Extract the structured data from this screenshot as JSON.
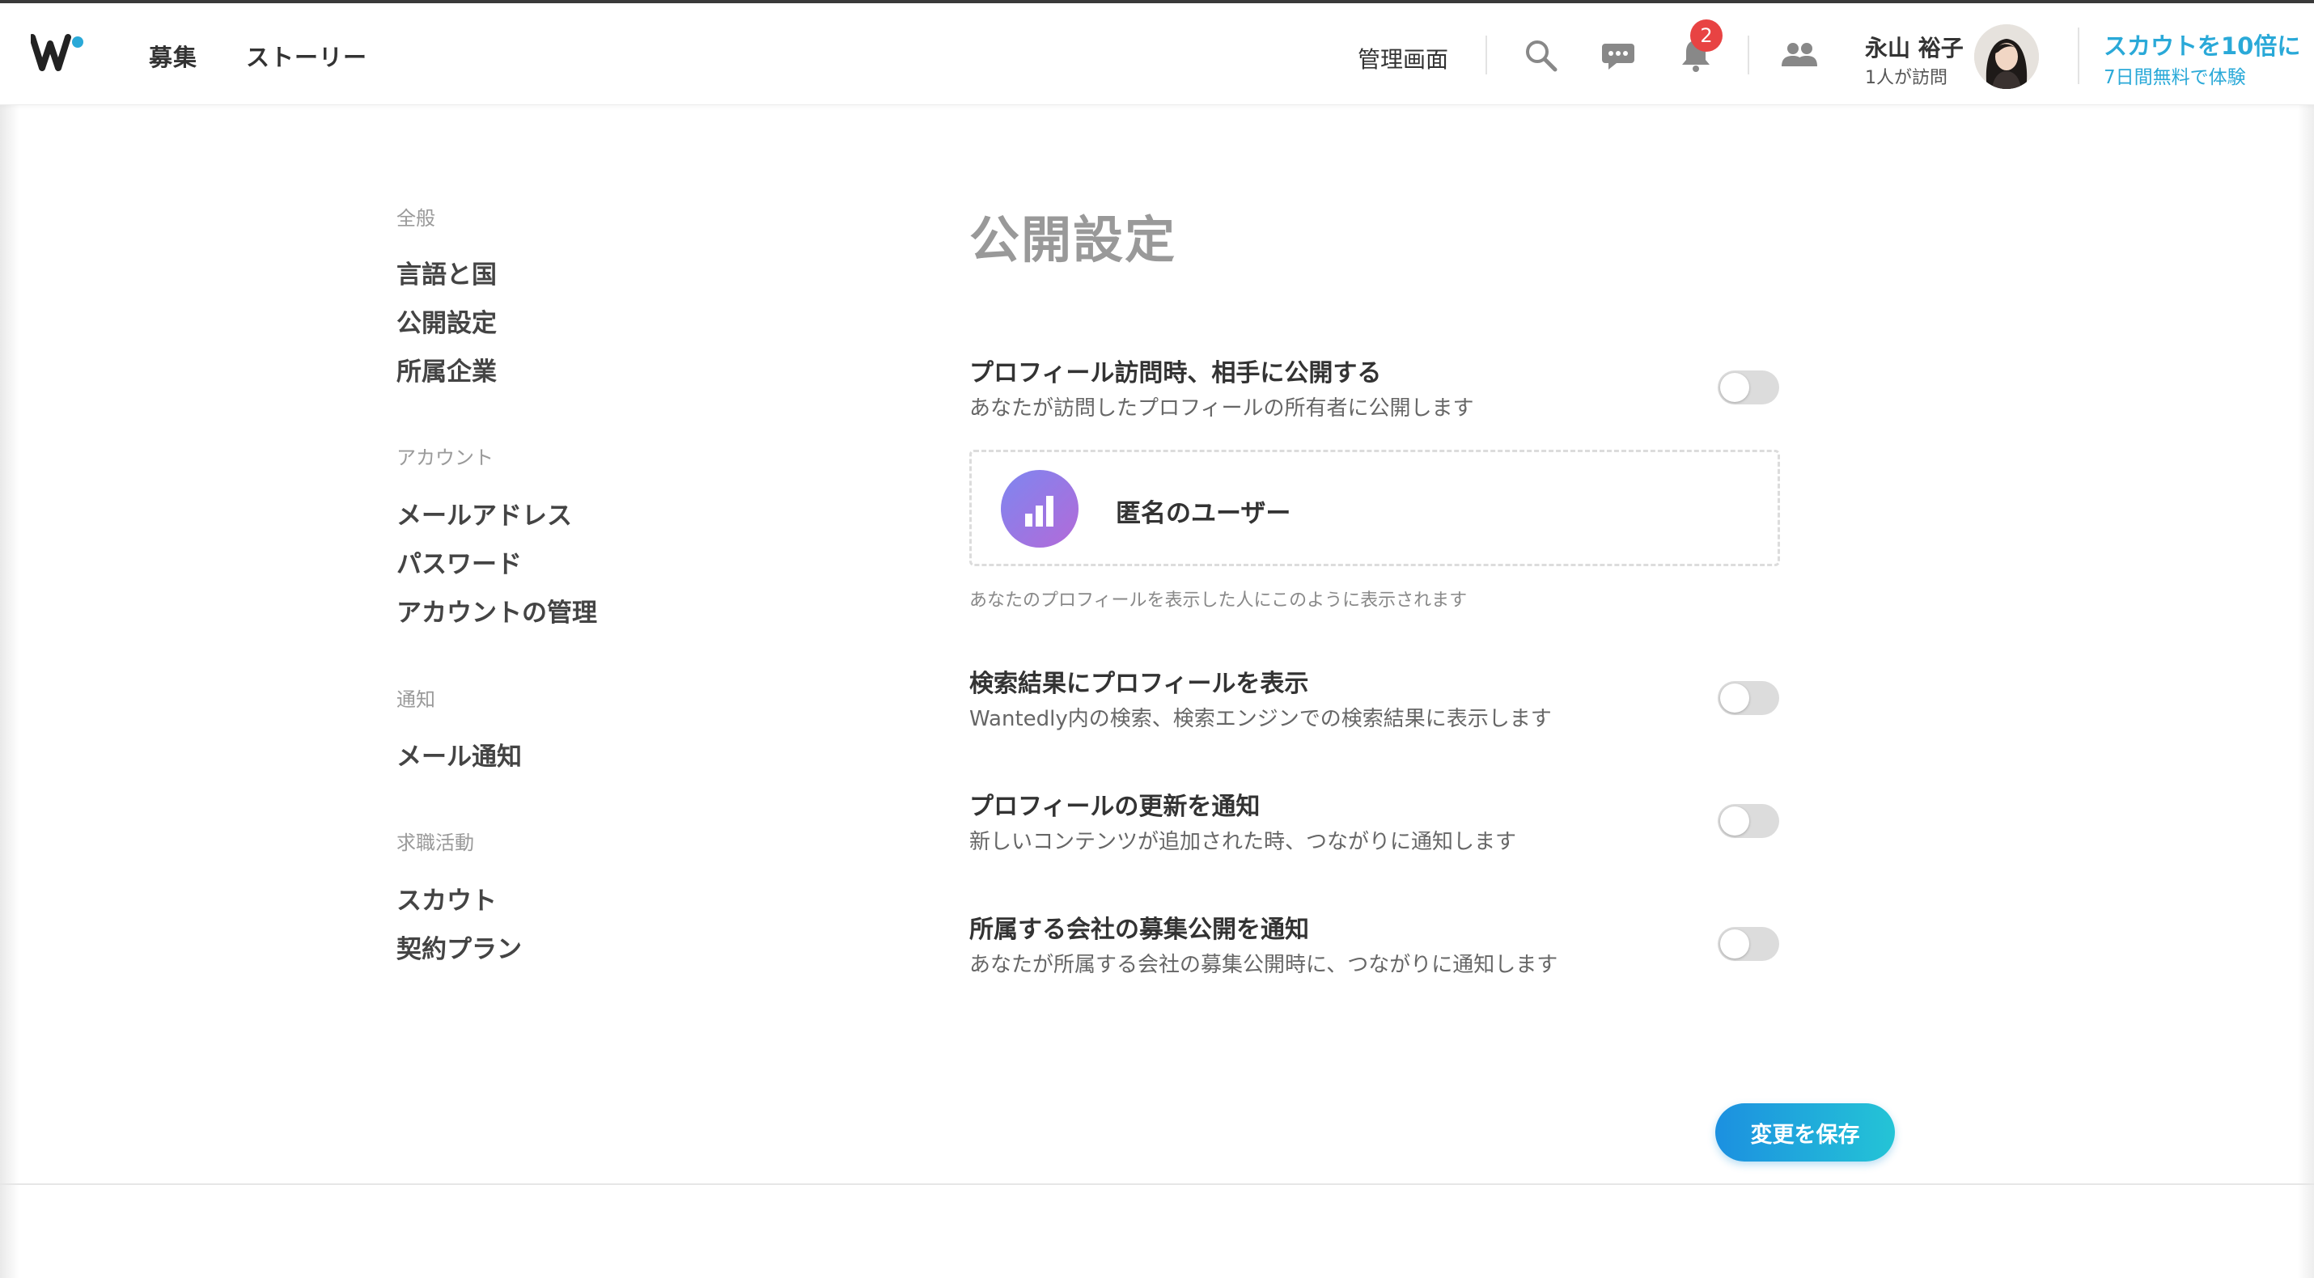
{
  "header": {
    "nav": {
      "jobs": "募集",
      "stories": "ストーリー"
    },
    "admin_link": "管理画面",
    "notification_count": "2",
    "user": {
      "name": "永山 裕子",
      "visits": "1人が訪問"
    },
    "scout": {
      "title": "スカウトを10倍に",
      "subtitle": "7日間無料で体験"
    },
    "icons": [
      "wantedly-logo",
      "search-icon",
      "chat-icon",
      "bell-icon",
      "people-icon"
    ]
  },
  "sidebar": {
    "general": {
      "heading": "全般",
      "items": [
        "言語と国",
        "公開設定",
        "所属企業"
      ]
    },
    "account": {
      "heading": "アカウント",
      "items": [
        "メールアドレス",
        "パスワード",
        "アカウントの管理"
      ]
    },
    "notifications": {
      "heading": "通知",
      "items": [
        "メール通知"
      ]
    },
    "job_hunting": {
      "heading": "求職活動",
      "items": [
        "スカウト",
        "契約プラン"
      ]
    }
  },
  "main": {
    "title": "公開設定",
    "settings": [
      {
        "title": "プロフィール訪問時、相手に公開する",
        "description": "あなたが訪問したプロフィールの所有者に公開します",
        "enabled": false
      },
      {
        "title": "検索結果にプロフィールを表示",
        "description": "Wantedly内の検索、検索エンジンでの検索結果に表示します",
        "enabled": false
      },
      {
        "title": "プロフィールの更新を通知",
        "description": "新しいコンテンツが追加された時、つながりに通知します",
        "enabled": false
      },
      {
        "title": "所属する会社の募集公開を通知",
        "description": "あなたが所属する会社の募集公開時に、つながりに通知します",
        "enabled": false
      }
    ],
    "preview": {
      "name": "匿名のユーザー",
      "note": "あなたのプロフィールを表示した人にこのように表示されます"
    },
    "save_label": "変更を保存"
  },
  "colors": {
    "accent": "#2aa9d8",
    "badge": "#e84343",
    "toggle_off": "#dcdcdc",
    "save_gradient_start": "#1c90e0",
    "save_gradient_end": "#24c4d6"
  }
}
